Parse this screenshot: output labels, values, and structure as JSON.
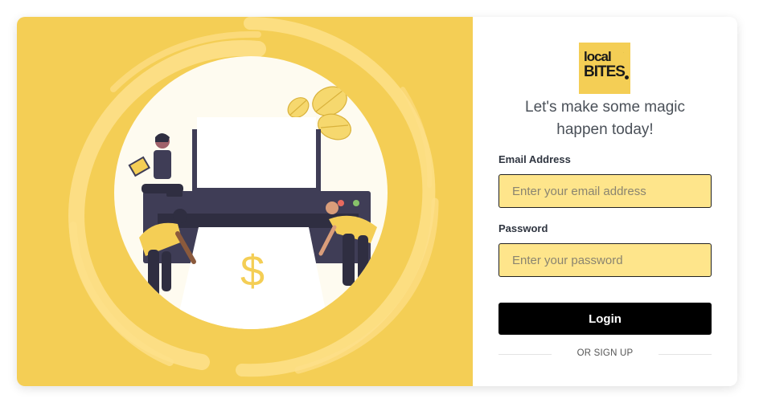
{
  "colors": {
    "hero_background": "#f4ce55",
    "input_background": "#fee58b",
    "button_background": "#000000",
    "button_text": "#ffffff"
  },
  "illustration": {
    "symbol": "$"
  },
  "logo": {
    "line1": "local",
    "line2": "BITES",
    "icon": "localbites-logo"
  },
  "tagline": {
    "line1": "Let's make some magic",
    "line2": "happen today!"
  },
  "form": {
    "email": {
      "label": "Email Address",
      "placeholder": "Enter your email address",
      "value": ""
    },
    "password": {
      "label": "Password",
      "placeholder": "Enter your password",
      "value": ""
    },
    "login_label": "Login",
    "signup_label": "OR SIGN UP"
  }
}
